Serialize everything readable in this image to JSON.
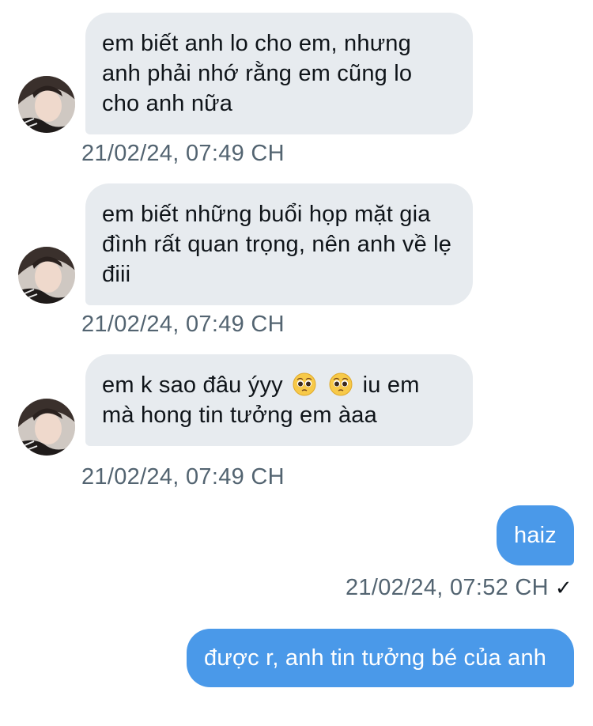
{
  "messages": [
    {
      "direction": "incoming",
      "text": "em biết anh lo cho em, nhưng anh phải nhớ rằng em cũng lo cho anh nữa",
      "time": "21/02/24, 07:49 CH"
    },
    {
      "direction": "incoming",
      "text": "em biết những buổi họp mặt gia đình rất quan trọng, nên anh về lẹ điii",
      "time": "21/02/24, 07:49 CH"
    },
    {
      "direction": "incoming",
      "text_before_emoji": "em k sao đâu ýyy",
      "text_after_emoji": "iu em mà hong tin tưởng em àaa",
      "emoji": [
        "pleading-face-emoji",
        "pleading-face-emoji"
      ],
      "time": "21/02/24, 07:49 CH"
    },
    {
      "direction": "outgoing",
      "text": "haiz",
      "time": "21/02/24, 07:52 CH",
      "status_icon": "checkmark-icon",
      "status_glyph": "✓"
    },
    {
      "direction": "outgoing",
      "text": "được r, anh tin tưởng bé của anh"
    }
  ],
  "colors": {
    "incoming_bubble": "#e7ebef",
    "outgoing_bubble": "#4a99e9",
    "timestamp": "#536471",
    "text_dark": "#0f1419"
  }
}
